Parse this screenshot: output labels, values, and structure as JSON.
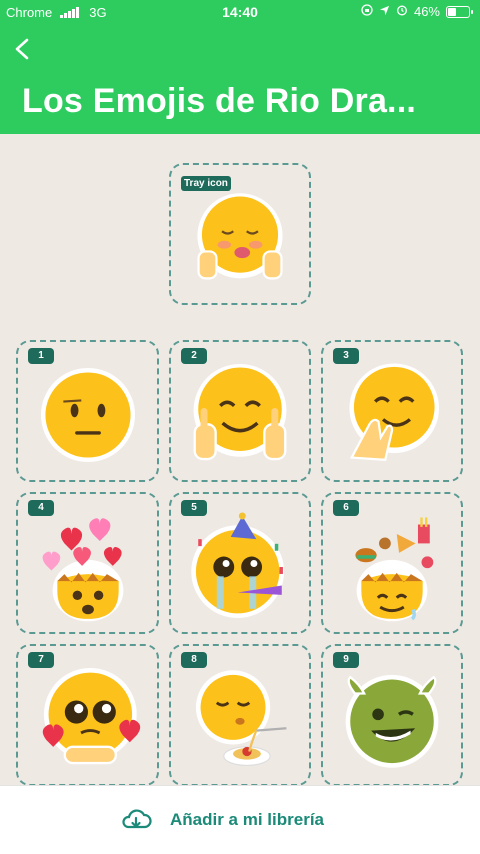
{
  "status_bar": {
    "carrier": "Chrome",
    "network": "3G",
    "time": "14:40",
    "battery": "46%",
    "battery_level": 0.46
  },
  "header": {
    "title": "Los Emojis de Rio Dra...",
    "back_icon": "chevron-left-icon"
  },
  "tray": {
    "label": "Tray icon",
    "sticker": "kissing-blushing-face"
  },
  "stickers": [
    {
      "number": "1",
      "sticker": "neutral-face"
    },
    {
      "number": "2",
      "sticker": "smiling-face-middle-fingers"
    },
    {
      "number": "3",
      "sticker": "giggling-face-hand"
    },
    {
      "number": "4",
      "sticker": "mind-blown-hearts"
    },
    {
      "number": "5",
      "sticker": "crying-party-face"
    },
    {
      "number": "6",
      "sticker": "mind-blown-food"
    },
    {
      "number": "7",
      "sticker": "pleading-face-hearts"
    },
    {
      "number": "8",
      "sticker": "kissing-face-spaghetti"
    },
    {
      "number": "9",
      "sticker": "green-winking-face"
    }
  ],
  "bottom": {
    "add_label": "Añadir a mi librería",
    "icon": "cloud-download-icon"
  },
  "colors": {
    "header": "#2ecc5f",
    "background": "#efe9e4",
    "accent": "#1b8a78",
    "badge": "#1f6b5b"
  }
}
